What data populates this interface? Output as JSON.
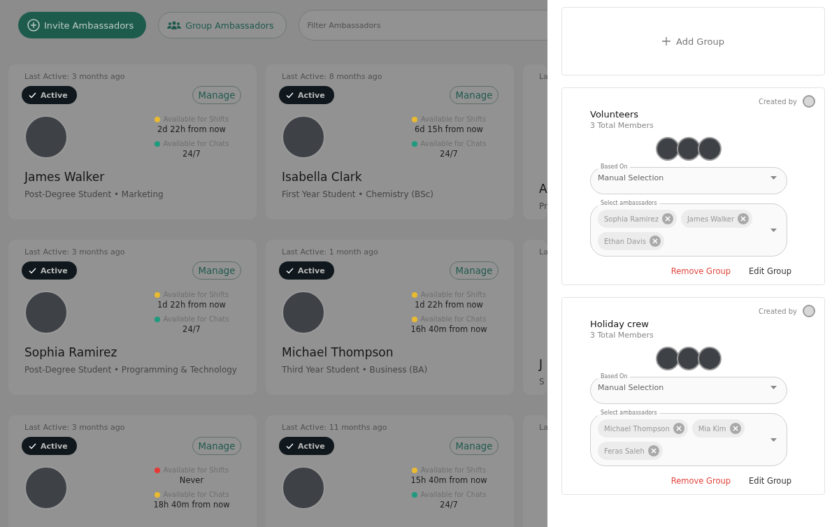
{
  "toolbar": {
    "invite_button": "Invite Ambassadors",
    "group_button": "Group Ambassadors",
    "filter": {
      "placeholder": "Filter Ambassadors"
    }
  },
  "cards": [
    {
      "kind": "full",
      "last_active": "Last Active: 3 months ago",
      "status": "Active",
      "manage": "Manage",
      "shifts": {
        "label": "Available for Shifts",
        "value": "2d 22h from now",
        "color": "#e8b931"
      },
      "chats": {
        "label": "Available for Chats",
        "value": "24/7",
        "color": "#1f9a7e"
      },
      "name": "James Walker",
      "subtitle": "Post-Degree Student • Marketing"
    },
    {
      "kind": "full",
      "last_active": "Last Active: 8 months ago",
      "status": "Active",
      "manage": "Manage",
      "shifts": {
        "label": "Available for Shifts",
        "value": "6d 15h from now",
        "color": "#e8b931"
      },
      "chats": {
        "label": "Available for Chats",
        "value": "24/7",
        "color": "#1f9a7e"
      },
      "name": "Isabella Clark",
      "subtitle": "First Year Student • Chemistry (BSc)"
    },
    {
      "kind": "clipped",
      "last_active": "La",
      "name": "A",
      "subtitle": "Pr"
    },
    {
      "kind": "full",
      "last_active": "Last Active: 3 months ago",
      "status": "Active",
      "manage": "Manage",
      "shifts": {
        "label": "Available for Shifts",
        "value": "1d 22h from now",
        "color": "#e8b931"
      },
      "chats": {
        "label": "Available for Chats",
        "value": "24/7",
        "color": "#1f9a7e"
      },
      "name": "Sophia Ramirez",
      "subtitle": "Post-Degree Student • Programming & Technology"
    },
    {
      "kind": "full",
      "last_active": "Last Active: 1 month ago",
      "status": "Active",
      "manage": "Manage",
      "shifts": {
        "label": "Available for Shifts",
        "value": "1d 22h from now",
        "color": "#e8b931"
      },
      "chats": {
        "label": "Available for Chats",
        "value": "16h 40m from now",
        "color": "#e8b931"
      },
      "name": "Michael Thompson",
      "subtitle": "Third Year Student • Business (BA)"
    },
    {
      "kind": "clipped",
      "last_active": "La",
      "name": "J",
      "subtitle": "S"
    },
    {
      "kind": "full",
      "last_active": "Last Active: 3 months ago",
      "status": "Active",
      "manage": "Manage",
      "shifts": {
        "label": "Available for Shifts",
        "value": "Never",
        "color": "#e53935"
      },
      "chats": {
        "label": "Available for Chats",
        "value": "18h 40m from now",
        "color": "#e8b931"
      }
    },
    {
      "kind": "full",
      "last_active": "Last Active: 11 months ago",
      "status": "Active",
      "manage": "Manage",
      "shifts": {
        "label": "Available for Shifts",
        "value": "15h 40m from now",
        "color": "#e8b931"
      },
      "chats": {
        "label": "Available for Chats",
        "value": "24/7",
        "color": "#1f9a7e"
      }
    },
    {
      "kind": "clipped",
      "last_active": "La"
    }
  ],
  "drawer": {
    "add_group": "Add Group",
    "groups": [
      {
        "created_by": "Created by",
        "title": "Volunteers",
        "members": "3 Total Members",
        "based_on": {
          "label": "Based On",
          "value": "Manual Selection"
        },
        "select": {
          "label": "Select ambassadors",
          "chips": [
            "Sophia Ramirez",
            "James Walker",
            "Ethan Davis"
          ]
        },
        "remove": "Remove Group",
        "edit": "Edit Group"
      },
      {
        "created_by": "Created by",
        "title": "Holiday crew",
        "members": "3 Total Members",
        "based_on": {
          "label": "Based On",
          "value": "Manual Selection"
        },
        "select": {
          "label": "Select ambassadors",
          "chips": [
            "Michael Thompson",
            "Mia Kim",
            "Feras Saleh"
          ]
        },
        "remove": "Remove Group",
        "edit": "Edit Group"
      }
    ]
  }
}
